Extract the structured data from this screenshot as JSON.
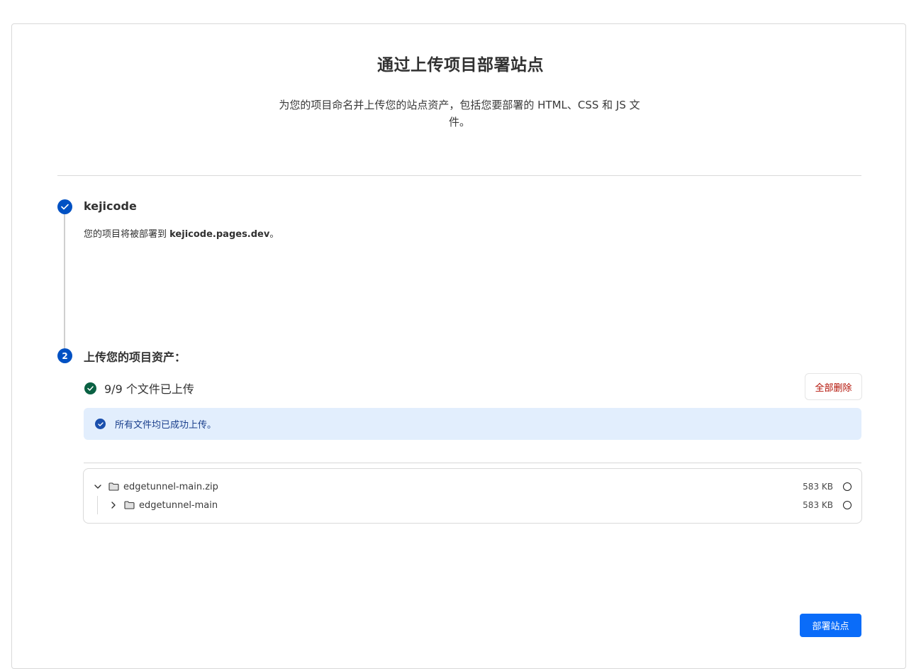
{
  "page": {
    "title": "通过上传项目部署站点",
    "subtitle": "为您的项目命名并上传您的站点资产，包括您要部署的 HTML、CSS 和 JS 文件。"
  },
  "step1": {
    "number_icon": "check-icon",
    "project_name": "kejicode",
    "desc_prefix": "您的项目将被部署到 ",
    "desc_domain": "kejicode.pages.dev",
    "desc_suffix": "。"
  },
  "step2": {
    "number": "2",
    "title": "上传您的项目资产：",
    "upload_status": "9/9 个文件已上传",
    "delete_all_label": "全部删除",
    "banner_text": "所有文件均已成功上传。",
    "files": [
      {
        "name": "edgetunnel-main.zip",
        "size": "583 KB",
        "expanded": true,
        "icon": "folder-icon"
      },
      {
        "name": "edgetunnel-main",
        "size": "583 KB",
        "expanded": false,
        "icon": "folder-icon"
      }
    ]
  },
  "actions": {
    "deploy_label": "部署站点"
  },
  "colors": {
    "primary": "#0051c3",
    "button_blue": "#0a6cf9",
    "success_green": "#0a6143",
    "danger_red": "#b20f03",
    "banner_bg": "#e2eefd"
  }
}
